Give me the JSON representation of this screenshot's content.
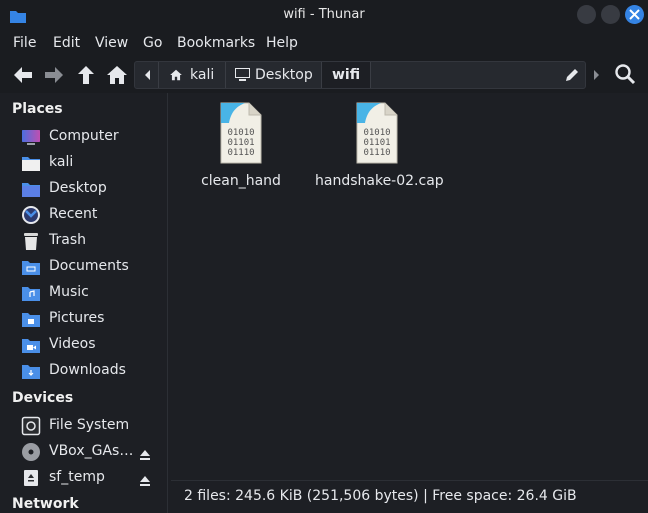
{
  "window": {
    "title": "wifi - Thunar"
  },
  "menu": [
    "File",
    "Edit",
    "View",
    "Go",
    "Bookmarks",
    "Help"
  ],
  "pathbar": {
    "crumbs": [
      "kali",
      "Desktop",
      "wifi"
    ]
  },
  "sidebar": {
    "places_heading": "Places",
    "places": [
      {
        "label": "Computer",
        "icon": "computer-icon"
      },
      {
        "label": "kali",
        "icon": "home-folder-icon"
      },
      {
        "label": "Desktop",
        "icon": "desktop-folder-icon"
      },
      {
        "label": "Recent",
        "icon": "recent-icon"
      },
      {
        "label": "Trash",
        "icon": "trash-icon"
      },
      {
        "label": "Documents",
        "icon": "documents-folder-icon"
      },
      {
        "label": "Music",
        "icon": "music-folder-icon"
      },
      {
        "label": "Pictures",
        "icon": "pictures-folder-icon"
      },
      {
        "label": "Videos",
        "icon": "videos-folder-icon"
      },
      {
        "label": "Downloads",
        "icon": "downloads-folder-icon"
      }
    ],
    "devices_heading": "Devices",
    "devices": [
      {
        "label": "File System",
        "icon": "drive-icon"
      },
      {
        "label": "VBox_GAs…",
        "icon": "optical-disc-icon"
      },
      {
        "label": "sf_temp",
        "icon": "removable-drive-icon"
      }
    ],
    "network_heading": "Network"
  },
  "files": [
    {
      "name": "clean_hand",
      "icon": "binary-file-icon",
      "icon_text": [
        "01010",
        "01101",
        "01110"
      ]
    },
    {
      "name": "handshake-02.cap",
      "icon": "binary-file-icon",
      "icon_text": [
        "01010",
        "01101",
        "01110"
      ]
    }
  ],
  "status": {
    "text": "2 files: 245.6 KiB (251,506 bytes) | Free space: 26.4 GiB"
  },
  "colors": {
    "accent": "#3584e4",
    "folder": "#4a8fe8",
    "background": "#1d1f24"
  }
}
